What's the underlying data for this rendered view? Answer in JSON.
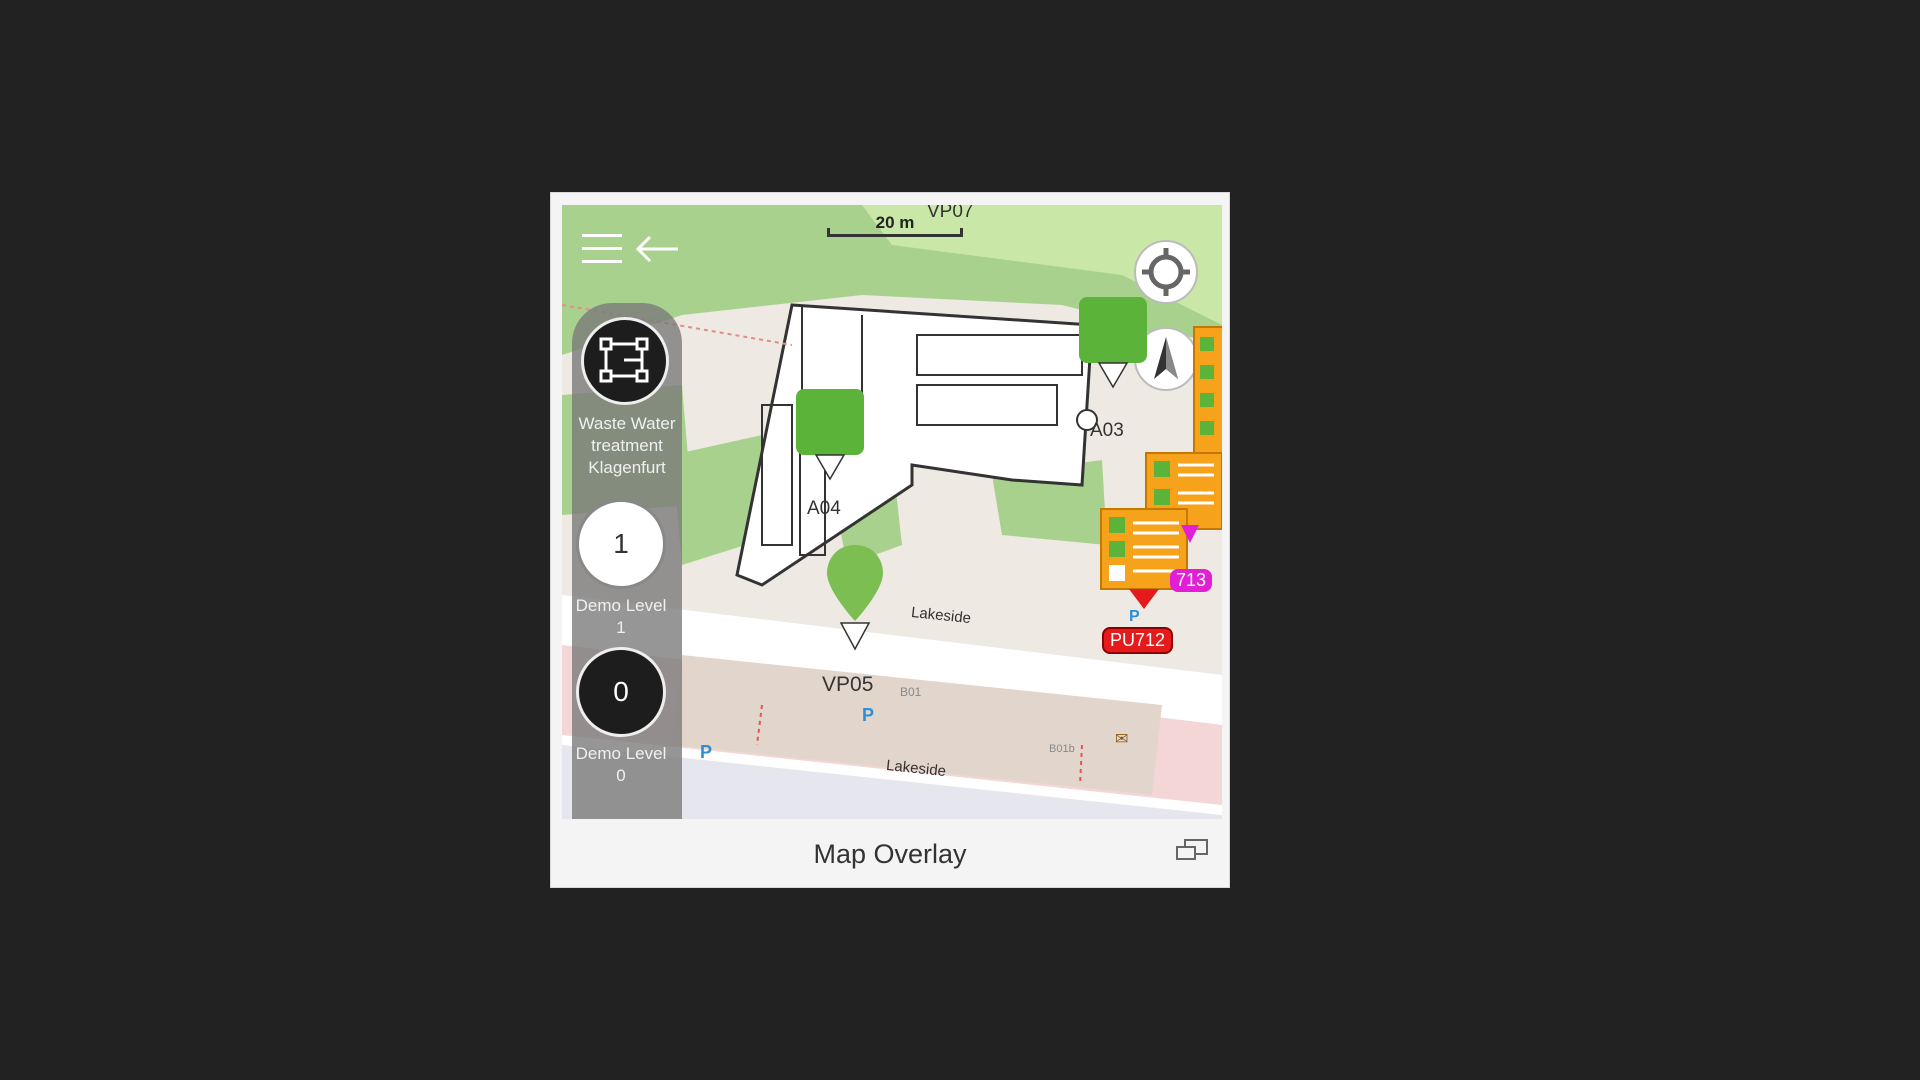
{
  "map": {
    "scale_label": "20 m",
    "top_label": "VP07",
    "labels": {
      "a03": "A03",
      "a04": "A04",
      "vp05": "VP05",
      "street_upper": "Lakeside",
      "street_lower": "Lakeside",
      "b01": "B01",
      "b01b": "B01b",
      "pu712": "PU712",
      "pu713": "713"
    }
  },
  "levels": {
    "site_label": "Waste Water treatment Klagenfurt",
    "level_1": {
      "number": "1",
      "label": "Demo Level 1"
    },
    "level_0": {
      "number": "0",
      "label": "Demo Level 0"
    }
  },
  "footer": {
    "title": "Map Overlay"
  },
  "colors": {
    "marker_green": "#5cb33a",
    "task_orange": "#f7a21b",
    "badge_red": "#e51b1b",
    "badge_magenta": "#e21fd4",
    "parking_blue": "#2d8fd5"
  },
  "icons": {
    "menu": "menu-icon",
    "back": "arrow-left-icon",
    "locate": "crosshair-icon",
    "compass": "compass-icon",
    "site": "floorplan-icon",
    "footer": "window-restore-icon"
  }
}
